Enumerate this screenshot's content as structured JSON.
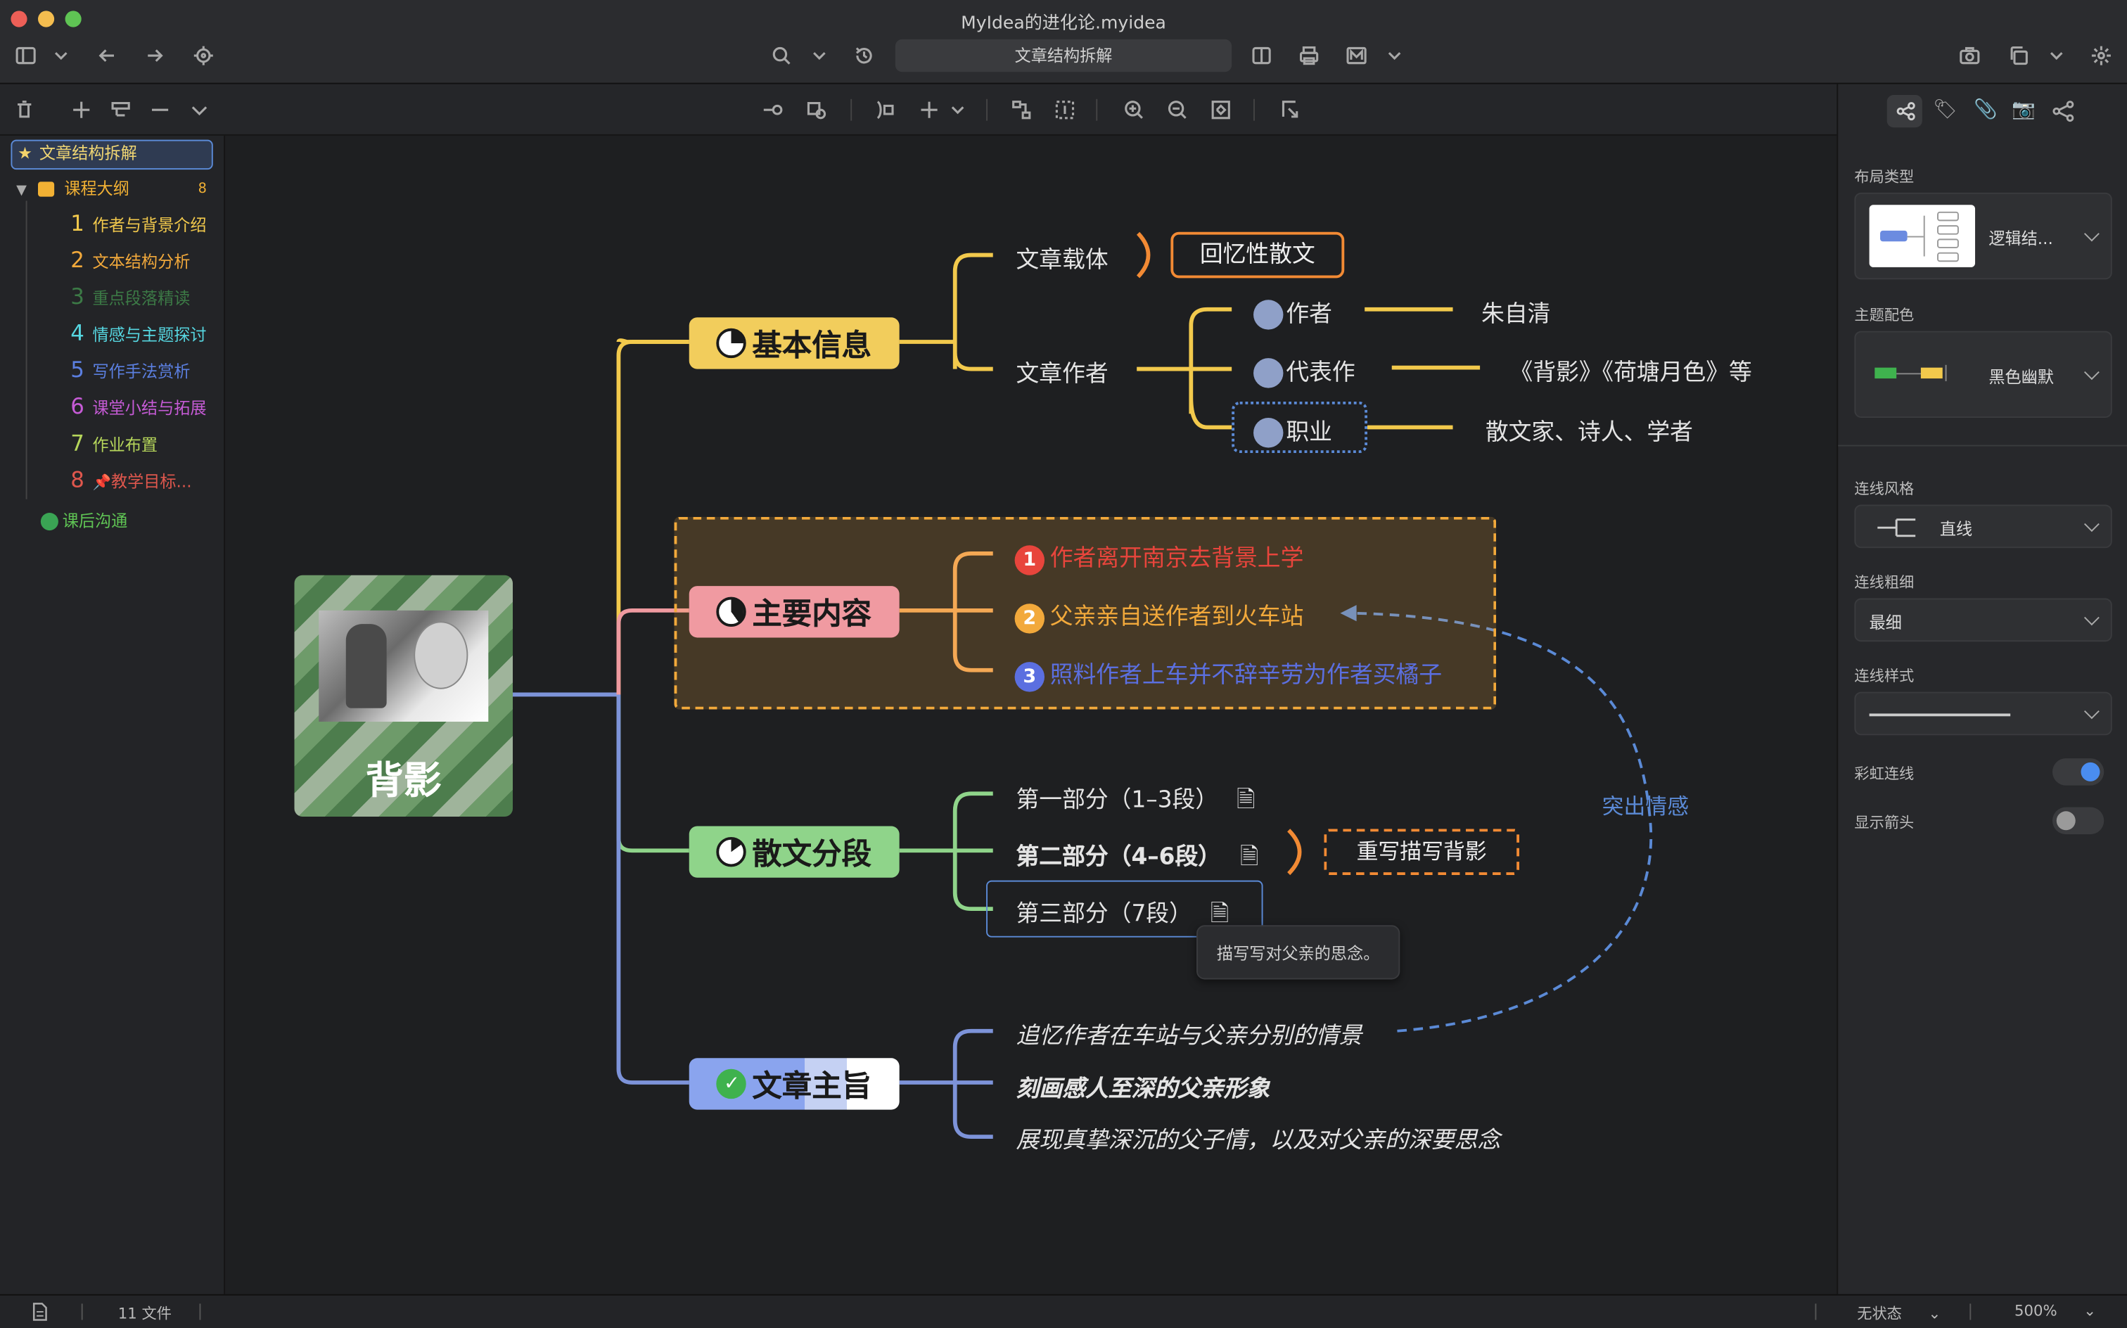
{
  "window": {
    "title": "MyIdea的进化论.myidea"
  },
  "toolbar": {
    "tab_title": "文章结构拆解"
  },
  "sidebar": {
    "selected": "文章结构拆解",
    "group": {
      "label": "课程大纲",
      "count": "8"
    },
    "items": [
      {
        "num": "1",
        "label": "作者与背景介绍",
        "color": "#f2c94c"
      },
      {
        "num": "2",
        "label": "文本结构分析",
        "color": "#f2a93b"
      },
      {
        "num": "3",
        "label": "重点段落精读",
        "color": "#3c7a46"
      },
      {
        "num": "4",
        "label": "情感与主题探讨",
        "color": "#56d6e0"
      },
      {
        "num": "5",
        "label": "写作手法赏析",
        "color": "#5b7fe0"
      },
      {
        "num": "6",
        "label": "课堂小结与拓展",
        "color": "#c65bd6"
      },
      {
        "num": "7",
        "label": "作业布置",
        "color": "#b6d65b"
      },
      {
        "num": "8",
        "label": "教学目标...",
        "color": "#e0574d"
      }
    ],
    "footer_item": "课后沟通"
  },
  "mindmap": {
    "root": "背影",
    "branches": {
      "basic": "基本信息",
      "content": "主要内容",
      "sections": "散文分段",
      "theme": "文章主旨"
    },
    "basic": {
      "carrier": "文章载体",
      "carrier_value": "回忆性散文",
      "author_label": "文章作者",
      "author": "作者",
      "author_value": "朱自清",
      "works": "代表作",
      "works_value": "《背影》《荷塘月色》等",
      "job": "职业",
      "job_value": "散文家、诗人、学者"
    },
    "content": [
      {
        "num": "1",
        "text": "作者离开南京去背景上学",
        "color": "#e8453c"
      },
      {
        "num": "2",
        "text": "父亲亲自送作者到火车站",
        "color": "#f2a93b"
      },
      {
        "num": "3",
        "text": "照料作者上车并不辞辛劳为作者买橘子",
        "color": "#5b6fe0"
      }
    ],
    "sections": {
      "part1": "第一部分（1–3段）",
      "part2": "第二部分（4–6段）",
      "part2_note": "重写描写背影",
      "part3": "第三部分（7段）",
      "tooltip": "描写写对父亲的思念。"
    },
    "theme": [
      "追忆作者在车站与父亲分别的情景",
      "刻画感人至深的父亲形象",
      "展现真挚深沉的父子情，以及对父亲的深要思念"
    ],
    "relation_label": "突出情感"
  },
  "right_panel": {
    "layout_type_label": "布局类型",
    "layout_type_value": "逻辑结...",
    "theme_color_label": "主题配色",
    "theme_color_value": "黑色幽默",
    "line_style_label": "连线风格",
    "line_style_value": "直线",
    "line_width_label": "连线粗细",
    "line_width_value": "最细",
    "line_pattern_label": "连线样式",
    "rainbow_label": "彩虹连线",
    "rainbow_on": true,
    "arrow_label": "显示箭头",
    "arrow_on": false
  },
  "status": {
    "files": "11 文件",
    "state": "无状态",
    "zoom": "500%"
  }
}
